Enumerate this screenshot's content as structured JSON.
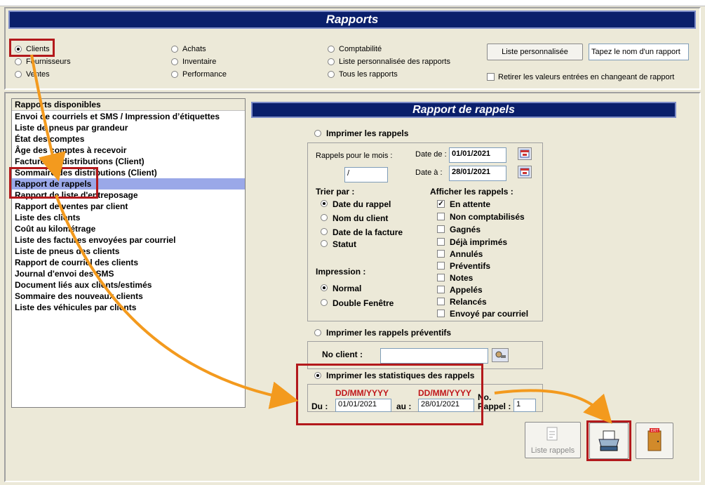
{
  "header": {
    "title": "Rapports"
  },
  "categories": {
    "col1": [
      {
        "label": "Clients",
        "selected": true
      },
      {
        "label": "Fournisseurs",
        "selected": false
      },
      {
        "label": "Ventes",
        "selected": false
      }
    ],
    "col2": [
      {
        "label": "Achats",
        "selected": false
      },
      {
        "label": "Inventaire",
        "selected": false
      },
      {
        "label": "Performance",
        "selected": false
      }
    ],
    "col3": [
      {
        "label": "Comptabilité",
        "selected": false
      },
      {
        "label": "Liste personnalisée des rapports",
        "selected": false
      },
      {
        "label": "Tous les rapports",
        "selected": false
      }
    ]
  },
  "custom": {
    "button_label": "Liste personnalisée",
    "input_value": "Tapez le nom d'un rapport",
    "reset_label": "Retirer les valeurs entrées en changeant de rapport"
  },
  "reports_list": {
    "header": "Rapports disponibles",
    "items": [
      "Envoi de courriels et SMS / Impression d’étiquettes",
      "Liste de pneus par grandeur",
      "État des comptes",
      "Âge des comptes à recevoir",
      "Factures et distributions (Client)",
      "Sommaire des distributions (Client)",
      "Rapport de rappels",
      "Rapport de liste d'entreposage",
      "Rapport de ventes par client",
      "Liste des clients",
      "Coût au kilométrage",
      "Liste des factures envoyées par courriel",
      "Liste de pneus des clients",
      "Rapport de courriel des clients",
      "Journal d'envoi des SMS",
      "Document liés aux clients/estimés",
      "Sommaire des nouveaux clients",
      "Liste des véhicules par clients"
    ],
    "selected_index": 6
  },
  "detail": {
    "title": "Rapport de rappels",
    "print_reminders_label": "Imprimer les rappels",
    "month_label": "Rappels pour le mois :",
    "month_value": "/",
    "date_from_label": "Date de :",
    "date_from_value": "01/01/2021",
    "date_to_label": "Date à :",
    "date_to_value": "28/01/2021",
    "sort_label": "Trier par :",
    "sort_options": [
      {
        "label": "Date du rappel",
        "selected": true
      },
      {
        "label": "Nom du client",
        "selected": false
      },
      {
        "label": "Date de la facture",
        "selected": false
      },
      {
        "label": "Statut",
        "selected": false
      }
    ],
    "print_label": "Impression :",
    "print_options": [
      {
        "label": "Normal",
        "selected": true
      },
      {
        "label": "Double Fenêtre",
        "selected": false
      }
    ],
    "show_label": "Afficher les rappels :",
    "show_options": [
      {
        "label": "En attente",
        "checked": true
      },
      {
        "label": "Non comptabilisés",
        "checked": false
      },
      {
        "label": "Gagnés",
        "checked": false
      },
      {
        "label": "Déjà imprimés",
        "checked": false
      },
      {
        "label": "Annulés",
        "checked": false
      },
      {
        "label": "Préventifs",
        "checked": false
      },
      {
        "label": "Notes",
        "checked": false
      },
      {
        "label": "Appelés",
        "checked": false
      },
      {
        "label": "Relancés",
        "checked": false
      },
      {
        "label": "Envoyé par courriel",
        "checked": false
      }
    ],
    "preventive_label": "Imprimer les rappels préventifs",
    "client_no_label": "No client :",
    "client_no_value": "",
    "stats_label": "Imprimer les statistiques des rappels",
    "stats_format": "DD/MM/YYYY",
    "stats_from_label": "Du :",
    "stats_from_value": "01/01/2021",
    "stats_to_label": "au :",
    "stats_to_value": "28/01/2021",
    "rappel_no_label_1": "No.",
    "rappel_no_label_2": "Rappel :",
    "rappel_no_value": "1",
    "list_button_label": "Liste rappels",
    "exit_icon_text": "EXIT"
  }
}
